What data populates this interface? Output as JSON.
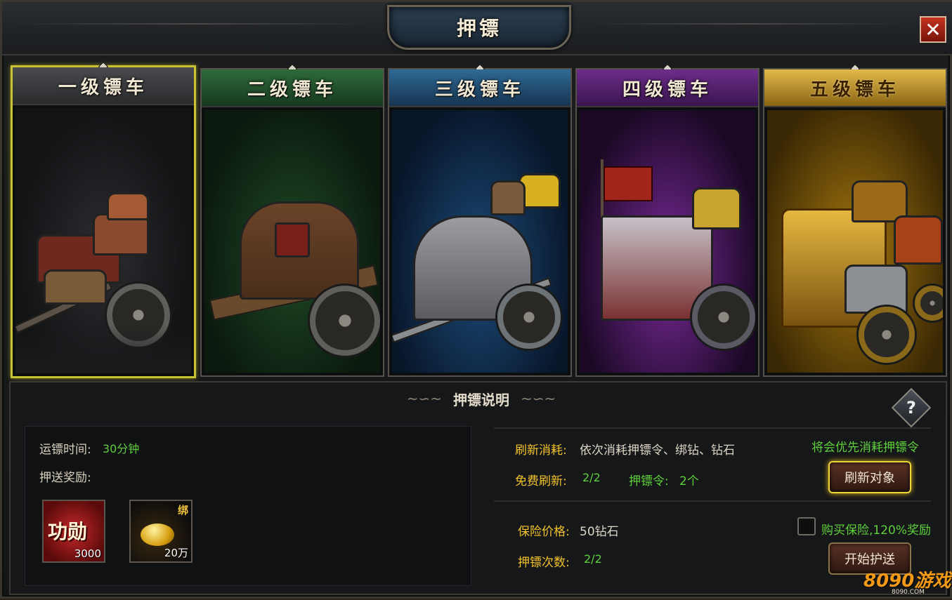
{
  "window": {
    "title": "押镖",
    "close_label": "✕"
  },
  "carts": [
    {
      "label": "一级镖车",
      "color": "#f0e7d2",
      "head_bg": "#3a3b3d",
      "selected": true
    },
    {
      "label": "二级镖车",
      "color": "#f0e7d2",
      "head_bg": "#1e4a2a",
      "selected": false
    },
    {
      "label": "三级镖车",
      "color": "#f0e7d2",
      "head_bg": "#1f4968",
      "selected": false
    },
    {
      "label": "四级镖车",
      "color": "#f0e7d2",
      "head_bg": "#55246a",
      "selected": false
    },
    {
      "label": "五级镖车",
      "color": "#3a2100",
      "head_bg": "#b48a1e",
      "selected": false
    }
  ],
  "explanation": {
    "title": "押镖说明",
    "help_label": "?",
    "transport_time_label": "运镖时间:",
    "transport_time_value": "30分钟",
    "reward_label": "押送奖励:",
    "rewards": [
      {
        "name": "功勋",
        "qty": "3000"
      },
      {
        "name": "绑",
        "qty": "20万"
      }
    ],
    "refresh_cost_label": "刷新消耗:",
    "refresh_cost_value": "依次消耗押镖令、绑钻、钻石",
    "priority_note": "将会优先消耗押镖令",
    "free_refresh_label": "免费刷新:",
    "free_refresh_value": "2/2",
    "token_label": "押镖令:",
    "token_value": "2个",
    "refresh_button": "刷新对象",
    "insurance_label": "保险价格:",
    "insurance_value": "50钻石",
    "buy_insurance_label": "购买保险,120%奖励",
    "escort_count_label": "押镖次数:",
    "escort_count_value": "2/2",
    "start_button": "开始护送"
  },
  "watermark": {
    "text": "8090游戏",
    "sub": "8090.COM"
  }
}
